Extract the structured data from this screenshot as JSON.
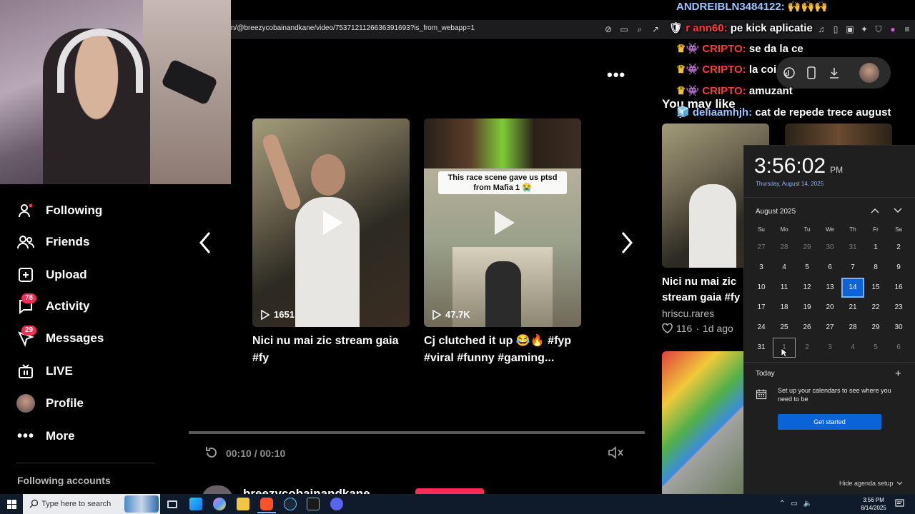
{
  "browser": {
    "url": "n/@breezycobainandkane/video/7537121126636391693?is_from_webapp=1"
  },
  "sidebar": {
    "items": [
      {
        "label": "Following",
        "icon": "following-icon"
      },
      {
        "label": "Friends",
        "icon": "friends-icon"
      },
      {
        "label": "Upload",
        "icon": "upload-icon"
      },
      {
        "label": "Activity",
        "icon": "activity-icon",
        "badge": "78"
      },
      {
        "label": "Messages",
        "icon": "messages-icon",
        "badge": "29"
      },
      {
        "label": "LIVE",
        "icon": "live-icon"
      },
      {
        "label": "Profile",
        "icon": "avatar"
      },
      {
        "label": "More",
        "icon": "more-icon"
      }
    ],
    "following_accounts": "Following accounts"
  },
  "videos": [
    {
      "views": "1651",
      "title": "Nici nu mai zic stream gaia #fy"
    },
    {
      "views": "47.7K",
      "title": "Cj clutched it up 😂🔥 #fyp #viral #funny #gaming...",
      "overlay": "This race scene gave us ptsd from Mafia 1 😭"
    }
  ],
  "player": {
    "time": "00:10 / 00:10",
    "username": "breezycobainandkane"
  },
  "recommend": {
    "heading": "You may like",
    "card": {
      "title_line1": "Nici nu mai zic",
      "title_line2": "stream gaia #fy",
      "author": "hriscu.rares",
      "likes": "116",
      "age": "1d ago"
    }
  },
  "chat": [
    {
      "user": "ANDREIBLN3484122:",
      "msg": "🙌🙌🙌",
      "style": "blue"
    },
    {
      "user": "r ann60:",
      "msg": "pe kick aplicatie",
      "style": "red"
    },
    {
      "user": "CRIPTO:",
      "msg": "se da la ce",
      "style": "red"
    },
    {
      "user": "CRIPTO:",
      "msg": "la coi",
      "style": "red"
    },
    {
      "user": "CRIPTO:",
      "msg": "amuzant",
      "style": "red"
    },
    {
      "user": "deliaamhjh:",
      "msg": "cat de repede trece august",
      "style": "blue"
    }
  ],
  "calendar": {
    "time": "3:56:02",
    "ampm": "PM",
    "date": "Thursday, August 14, 2025",
    "month": "August 2025",
    "weekdays": [
      "Su",
      "Mo",
      "Tu",
      "We",
      "Th",
      "Fr",
      "Sa"
    ],
    "weeks": [
      [
        "27",
        "28",
        "29",
        "30",
        "31",
        "1",
        "2"
      ],
      [
        "3",
        "4",
        "5",
        "6",
        "7",
        "8",
        "9"
      ],
      [
        "10",
        "11",
        "12",
        "13",
        "14",
        "15",
        "16"
      ],
      [
        "17",
        "18",
        "19",
        "20",
        "21",
        "22",
        "23"
      ],
      [
        "24",
        "25",
        "26",
        "27",
        "28",
        "29",
        "30"
      ],
      [
        "31",
        "1",
        "2",
        "3",
        "4",
        "5",
        "6"
      ]
    ],
    "today_label": "Today",
    "agenda_text": "Set up your calendars to see where you need to be",
    "get_started": "Get started",
    "hide_agenda": "Hide agenda setup"
  },
  "taskbar": {
    "search_placeholder": "Type here to search",
    "clock_time": "3:56 PM",
    "clock_date": "8/14/2025"
  },
  "colors": {
    "accent": "#fe2c55",
    "win_blue": "#0a64d8"
  }
}
